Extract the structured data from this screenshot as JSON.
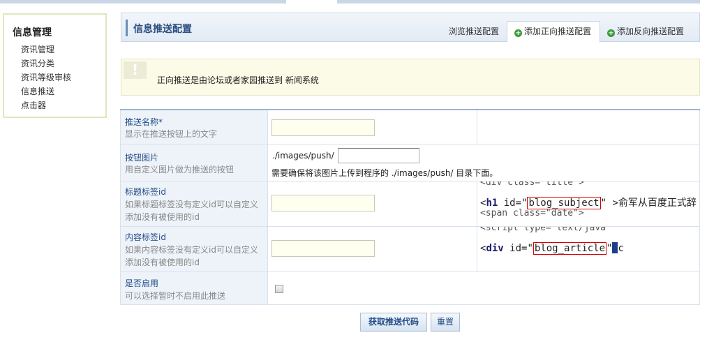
{
  "sidebar": {
    "title": "信息管理",
    "items": [
      {
        "label": "资讯管理"
      },
      {
        "label": "资讯分类"
      },
      {
        "label": "资讯等级审核"
      },
      {
        "label": "信息推送"
      },
      {
        "label": "点击器"
      }
    ]
  },
  "header": {
    "title": "信息推送配置",
    "tabs": {
      "browse": "浏览推送配置",
      "add_forward": "添加正向推送配置",
      "add_reverse": "添加反向推送配置"
    }
  },
  "notice": {
    "icon": "!",
    "text": "正向推送是由论坛或者家园推送到 新闻系统"
  },
  "form": {
    "push_name": {
      "label": "推送名称*",
      "desc": "显示在推送按钮上的文字",
      "value": ""
    },
    "button_image": {
      "label": "按钮图片",
      "desc": "用自定义图片做为推送的按钮",
      "prefix": "./images/push/",
      "value": "",
      "hint": "需要确保将该图片上传到程序的 ./images/push/ 目录下面。"
    },
    "title_tag": {
      "label": "标题标签id",
      "desc_line1": "如果标题标签没有定义id可以自定义",
      "desc_line2": "添加没有被使用的id",
      "value": "",
      "code_top": "<div class=\"title\">",
      "code_open": "<",
      "code_tag": "h1",
      "code_attr": " id=\"",
      "code_id": "blog_subject",
      "code_rest": "\" >俞军从百度正式辞",
      "code_bottom": "    <span class=\"date\">"
    },
    "content_tag": {
      "label": "内容标签id",
      "desc_line1": "如果内容标签没有定义id可以自定义",
      "desc_line2": "添加没有被使用的id",
      "value": "",
      "code_top": "<script type=\"text/java",
      "code_open": "<",
      "code_tag": "div",
      "code_attr": " id=\"",
      "code_id": "blog_article",
      "code_rest": "\"",
      "code_after": "c"
    },
    "enable": {
      "label": "是否启用",
      "desc": "可以选择暂时不启用此推送",
      "checked": false
    }
  },
  "buttons": {
    "submit": "获取推送代码",
    "reset": "重置"
  }
}
